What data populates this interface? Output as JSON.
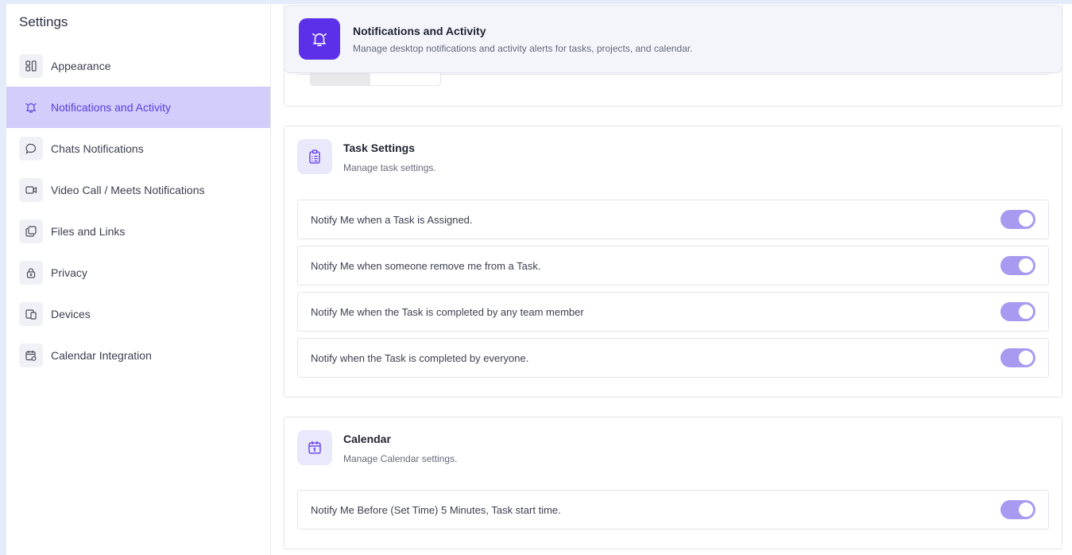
{
  "sidebar": {
    "title": "Settings",
    "items": [
      {
        "label": "Appearance",
        "icon": "layout-icon"
      },
      {
        "label": "Notifications and Activity",
        "icon": "bell-icon",
        "active": true
      },
      {
        "label": "Chats Notifications",
        "icon": "chat-icon"
      },
      {
        "label": "Video Call / Meets Notifications",
        "icon": "video-icon"
      },
      {
        "label": "Files and Links",
        "icon": "files-icon"
      },
      {
        "label": "Privacy",
        "icon": "lock-icon"
      },
      {
        "label": "Devices",
        "icon": "devices-icon"
      },
      {
        "label": "Calendar Integration",
        "icon": "calendar-sync-icon"
      }
    ]
  },
  "header": {
    "title": "Notifications and Activity",
    "description": "Manage desktop notifications and activity alerts for tasks, projects, and calendar.",
    "icon": "bell-icon"
  },
  "task_settings": {
    "title": "Task Settings",
    "description": "Manage task settings.",
    "icon": "clipboard-icon",
    "options": [
      {
        "label": "Notify Me when a Task is Assigned.",
        "enabled": true
      },
      {
        "label": "Notify Me when someone remove me from a Task.",
        "enabled": true
      },
      {
        "label": "Notify Me when the Task is completed by any team member",
        "enabled": true
      },
      {
        "label": "Notify when the Task is completed by everyone.",
        "enabled": true
      }
    ]
  },
  "calendar": {
    "title": "Calendar",
    "description": "Manage Calendar settings.",
    "icon": "calendar-icon",
    "options": [
      {
        "label": "Notify Me Before (Set Time) 5 Minutes, Task start time.",
        "enabled": true
      }
    ]
  },
  "colors": {
    "accent": "#5b30e8",
    "active_nav_bg": "#d2cdfa",
    "toggle_on": "#a89af0",
    "page_bg": "#e4ebfa"
  }
}
